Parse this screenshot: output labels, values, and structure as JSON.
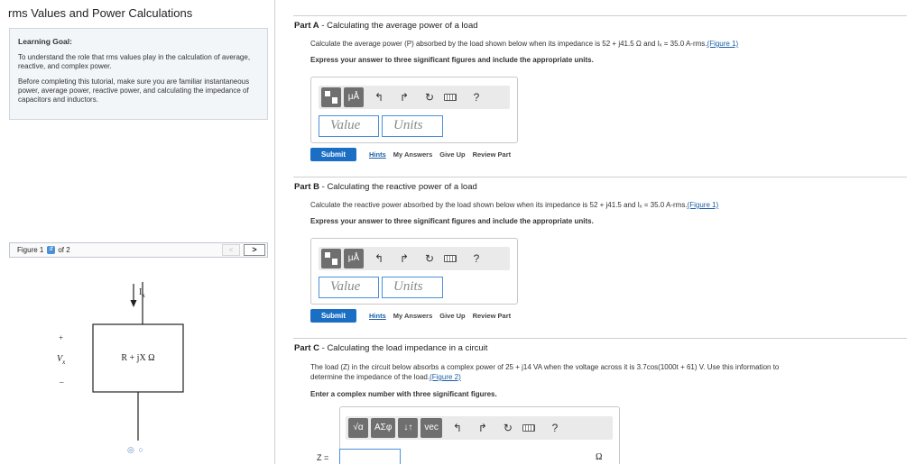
{
  "page": {
    "title": "rms Values and Power Calculations"
  },
  "learning_goal": {
    "heading": "Learning Goal:",
    "paragraph1": "To understand the role that rms values play in the calculation of average, reactive, and complex power.",
    "paragraph2": "Before completing this tutorial, make sure you are familiar instantaneous power, average power, reactive power, and calculating the impedance of capacitors and inductors."
  },
  "figure": {
    "label": "Figure 1",
    "of_label": "of 2",
    "prev_label": "<",
    "next_label": ">",
    "current_label": "I",
    "current_sub": "x",
    "voltage_label": "V",
    "voltage_sub": "x",
    "plus": "+",
    "minus": "–",
    "impedance_label": "R + jX Ω",
    "pager": "◎ ○"
  },
  "parts": [
    {
      "label": "Part A",
      "title": "Calculating the average power of a load",
      "text": "Calculate the average power (P) absorbed by the load shown below when its impedance is 52 + j41.5 Ω and Iₓ = 35.0 A-rms.",
      "figure_link": "(Figure 1)",
      "instruction": "Express your answer to three significant figures and include the appropriate units."
    },
    {
      "label": "Part B",
      "title": "Calculating the reactive power of a load",
      "text": "Calculate the reactive power absorbed by the load shown below when its impedance is 52 + j41.5 and Iₓ = 35.0 A-rms.",
      "figure_link": "(Figure 1)",
      "instruction": "Express your answer to three significant figures and include the appropriate units."
    },
    {
      "label": "Part C",
      "title": "Calculating the load impedance in a circuit",
      "text_line1": "The load (Z) in the circuit below absorbs a complex power of 25 + j14 VA when the voltage across it is 3.7cos(1000t + 61) V. Use this information to",
      "text_line2": "determine the impedance of the load.",
      "figure_link": "(Figure 2)",
      "instruction": "Enter a complex number with three significant figures."
    }
  ],
  "answer": {
    "value_placeholder": "Value",
    "units_placeholder": "Units",
    "mu_label": "μÅ",
    "help_label": "?",
    "undo_icon": "↰",
    "redo_icon": "↱",
    "reset_icon": "↻"
  },
  "answer_c": {
    "sqrt_label": "√α",
    "greek_label": "ΑΣφ",
    "arrows_label": "↓↑",
    "vec_label": "vec",
    "z_label": "Z =",
    "unit_label": "Ω"
  },
  "actions": {
    "submit": "Submit",
    "hints": "Hints",
    "my_answers": "My Answers",
    "give_up": "Give Up",
    "review_part": "Review Part"
  }
}
